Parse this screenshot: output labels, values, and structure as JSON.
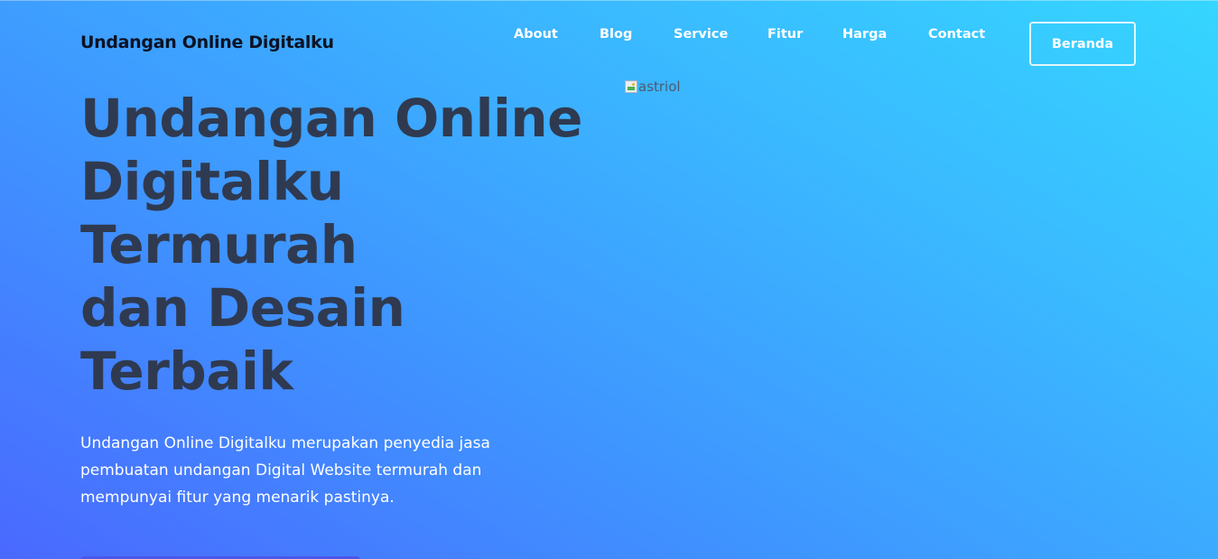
{
  "header": {
    "brand": "Undangan Online Digitalku",
    "nav": [
      "About",
      "Blog",
      "Service",
      "Fitur",
      "Harga",
      "Contact"
    ],
    "cta_label": "Beranda"
  },
  "hero": {
    "title_lines": [
      "Undangan Online",
      "Digitalku",
      "Termurah",
      "dan Desain",
      "Terbaik"
    ],
    "description": "Undangan Online Digitalku merupakan penyedia jasa pembuatan undangan Digital Website termurah dan mempunyai fitur yang menarik pastinya.",
    "image_alt": "astriol",
    "button_color": "#4b57e8"
  },
  "colors": {
    "gradient_start": "#4a69ff",
    "gradient_end": "#35d6ff",
    "title_color": "#2f3a50",
    "brand_color": "#0c1224"
  }
}
